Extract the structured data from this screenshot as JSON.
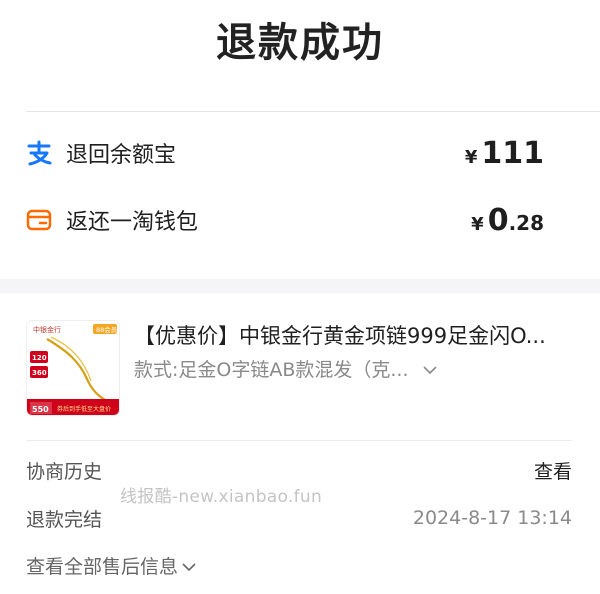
{
  "header": {
    "title": "退款成功"
  },
  "refunds": [
    {
      "label": "退回余额宝",
      "currency": "¥",
      "amount_main": "111",
      "amount_decimal": "",
      "icon": "alipay-icon",
      "icon_color": "#1677ff"
    },
    {
      "label": "返还一淘钱包",
      "currency": "¥",
      "amount_main": "0",
      "amount_decimal": ".28",
      "icon": "wallet-icon",
      "icon_color": "#ff6a00"
    }
  ],
  "product": {
    "title": "【优惠价】中银金行黄金项链999足金闪O...",
    "spec": "款式:足金O字链AB款混发（克...",
    "thumbnail": {
      "brand": "中银金行",
      "tag": "88会员",
      "price_a": "120",
      "price_b": "360",
      "price_c": "550",
      "banner": "券后到手低至大盘价"
    }
  },
  "info": {
    "history_label": "协商历史",
    "history_action": "查看",
    "status_label": "退款完结",
    "status_time": "2024-8-17 13:14"
  },
  "watermark": "线报酷-new.xianbao.fun",
  "footer": {
    "more_label": "查看全部售后信息"
  },
  "colors": {
    "accent_blue": "#1677ff",
    "accent_orange": "#ff6a00",
    "thumb_red": "#d0021b",
    "gold": "#d4a017"
  }
}
